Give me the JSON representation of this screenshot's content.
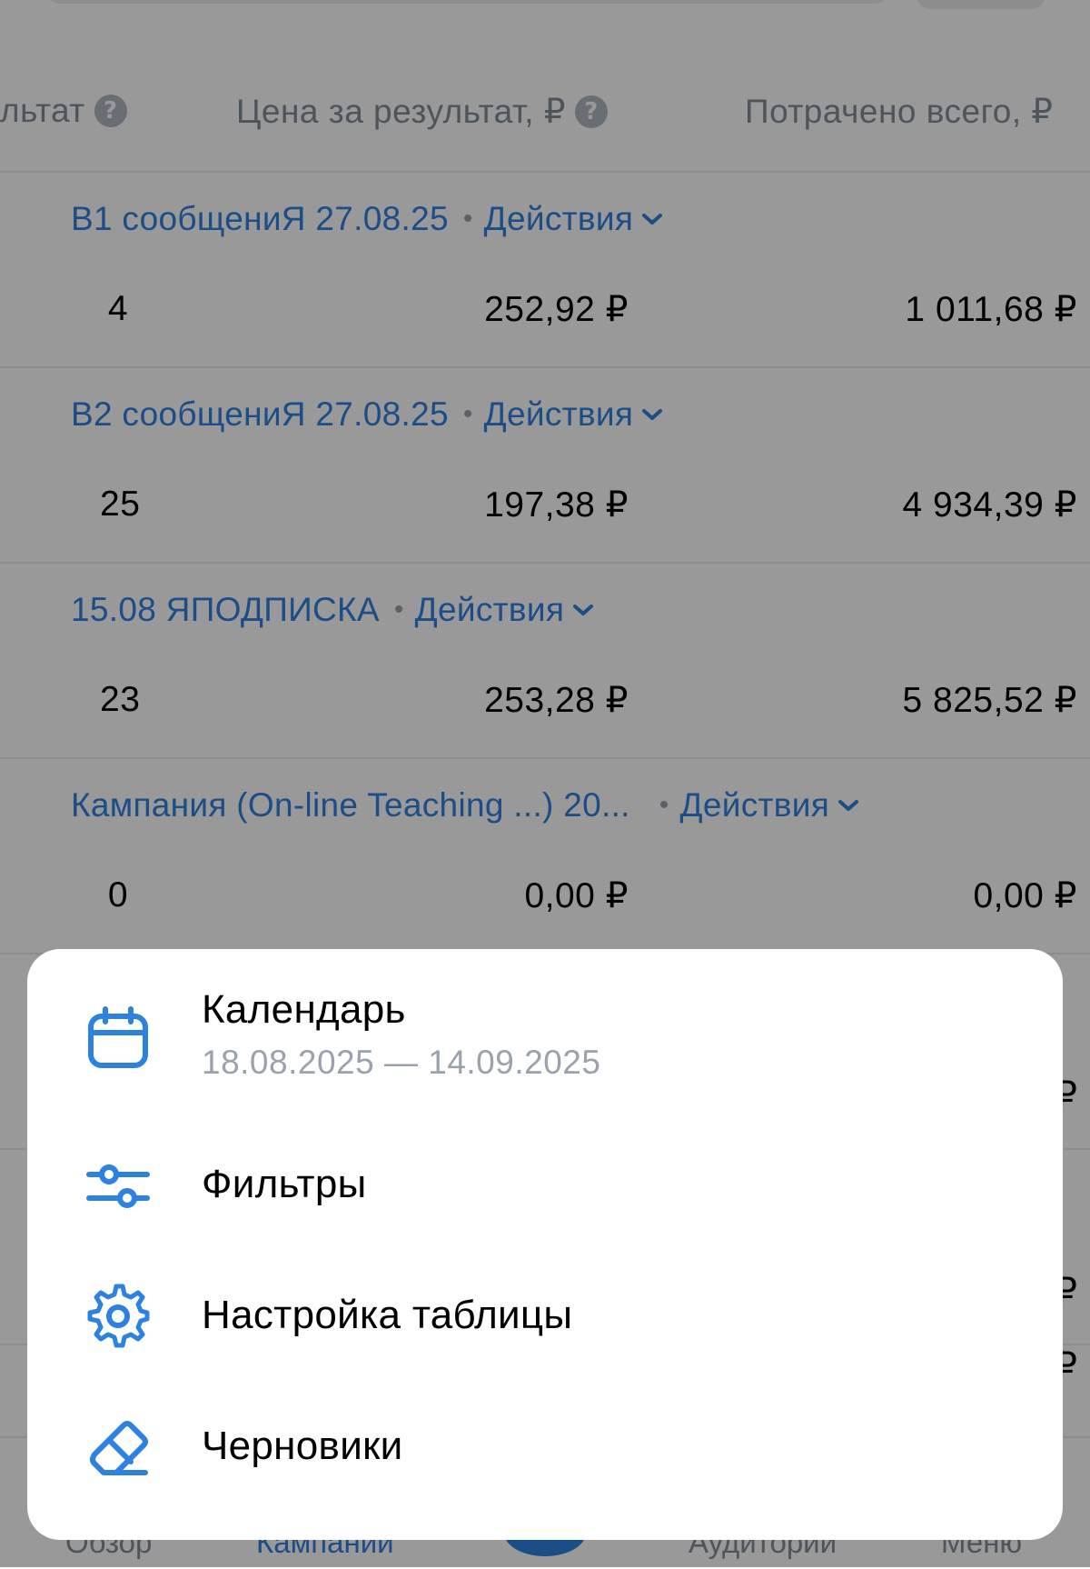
{
  "header": {
    "col_result_partial": "льтат",
    "col_price": "Цена за результат, ₽",
    "col_spent": "Потрачено всего, ₽",
    "help_glyph": "?"
  },
  "campaigns": [
    {
      "name": "В1 сообщениЯ 27.08.25",
      "actions_label": "Действия",
      "result": "4",
      "price": "252,92 ₽",
      "spent": "1 011,68 ₽"
    },
    {
      "name": "В2 сообщениЯ 27.08.25",
      "actions_label": "Действия",
      "result": "25",
      "price": "197,38 ₽",
      "spent": "4 934,39 ₽"
    },
    {
      "name": "15.08 ЯПОДПИСКА",
      "actions_label": "Действия",
      "result": "23",
      "price": "253,28 ₽",
      "spent": "5 825,52 ₽"
    },
    {
      "name": "Кампания (On-line Teaching ...) 20...",
      "actions_label": "Действия",
      "result": "0",
      "price": "0,00 ₽",
      "spent": "0,00 ₽"
    }
  ],
  "hidden_row_currency_glyph": "₽",
  "tab_bar": {
    "overview": "Обзор",
    "campaigns": "Кампании",
    "audiences": "Аудитории",
    "menu": "Меню"
  },
  "menu": {
    "calendar": {
      "label": "Календарь",
      "date_range": "18.08.2025 — 14.09.2025",
      "icon": "calendar-icon"
    },
    "filters": {
      "label": "Фильтры",
      "icon": "sliders-icon"
    },
    "table_settings": {
      "label": "Настройка таблицы",
      "icon": "gear-icon"
    },
    "drafts": {
      "label": "Черновики",
      "icon": "eraser-icon"
    }
  },
  "colors": {
    "accent": "#2d81e0",
    "overlay": "rgba(0,0,0,0.40)",
    "secondary_text": "#818c99"
  }
}
